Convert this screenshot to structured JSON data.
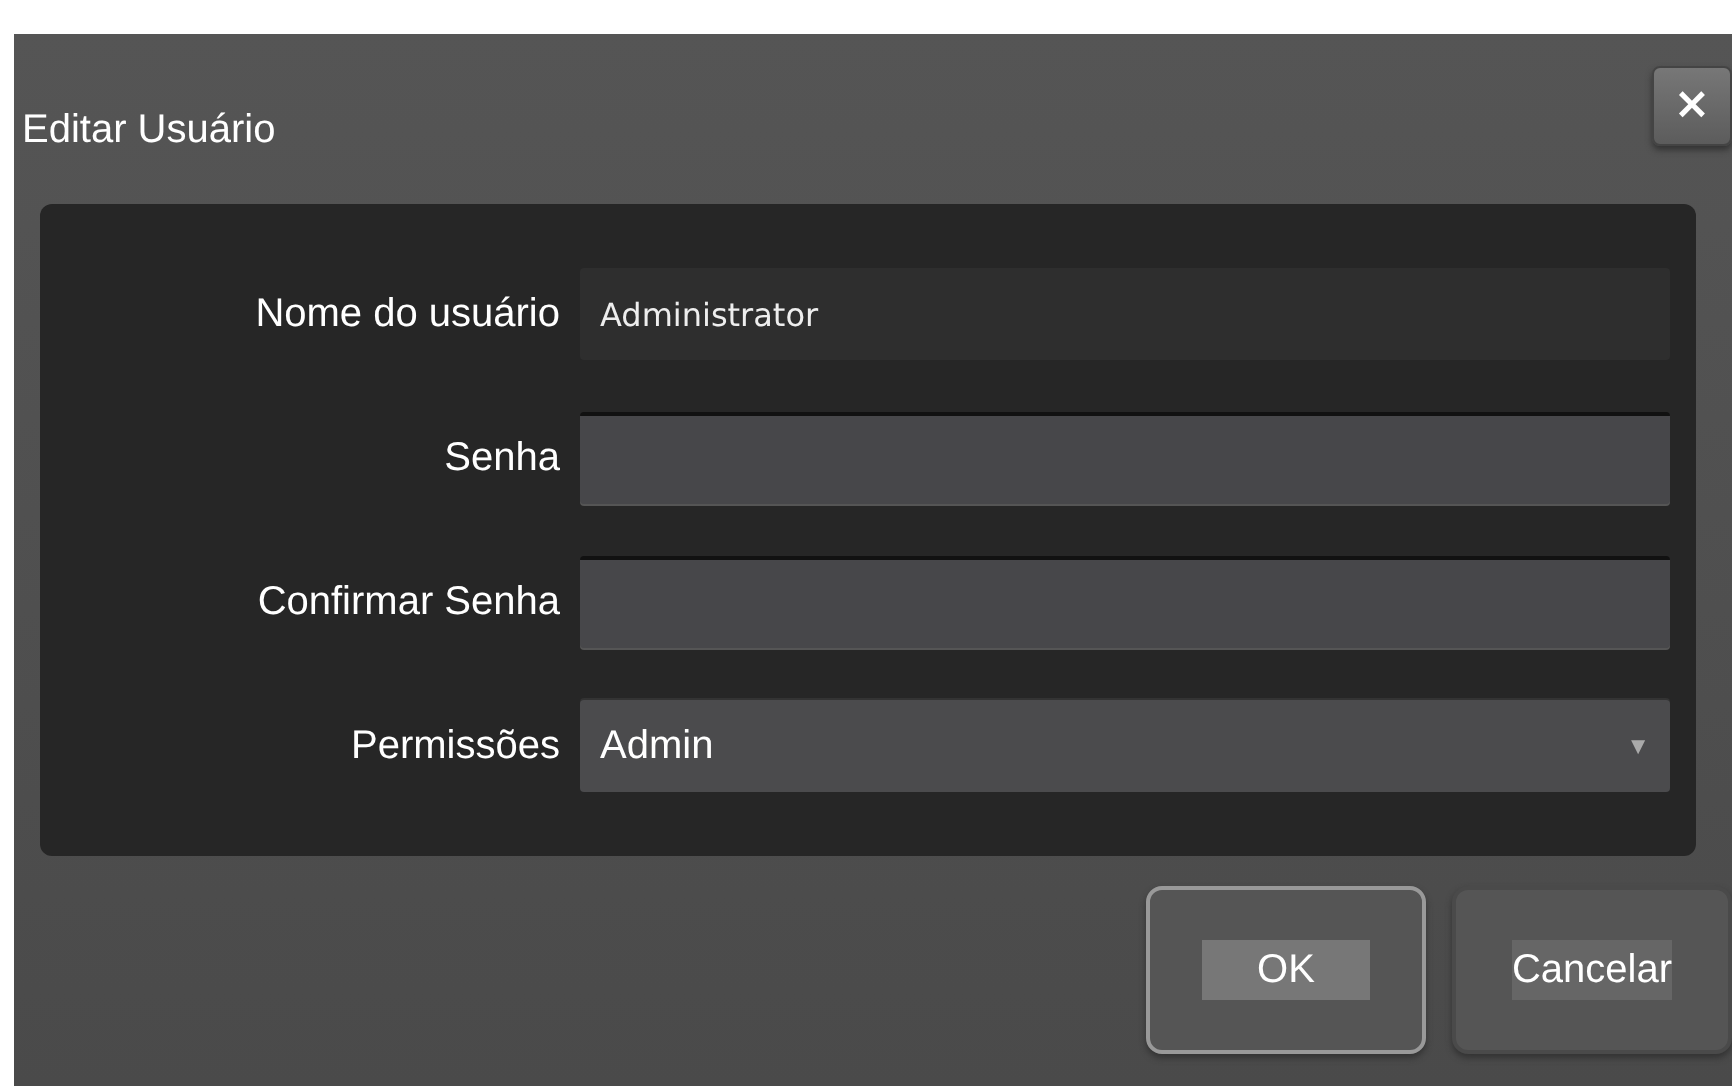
{
  "dialog": {
    "title": "Editar Usuário",
    "close": "×"
  },
  "fields": [
    {
      "kind": "text",
      "label": "Nome do usuário",
      "value": "Administrator"
    },
    {
      "kind": "password",
      "label": "Senha"
    },
    {
      "kind": "password",
      "label": "Confirmar Senha"
    },
    {
      "kind": "select",
      "label": "Permissões",
      "value": "Admin",
      "caret": "▼"
    }
  ],
  "buttons": [
    {
      "label": "OK",
      "focused": true
    },
    {
      "label": "Cancelar",
      "focused": false
    }
  ]
}
